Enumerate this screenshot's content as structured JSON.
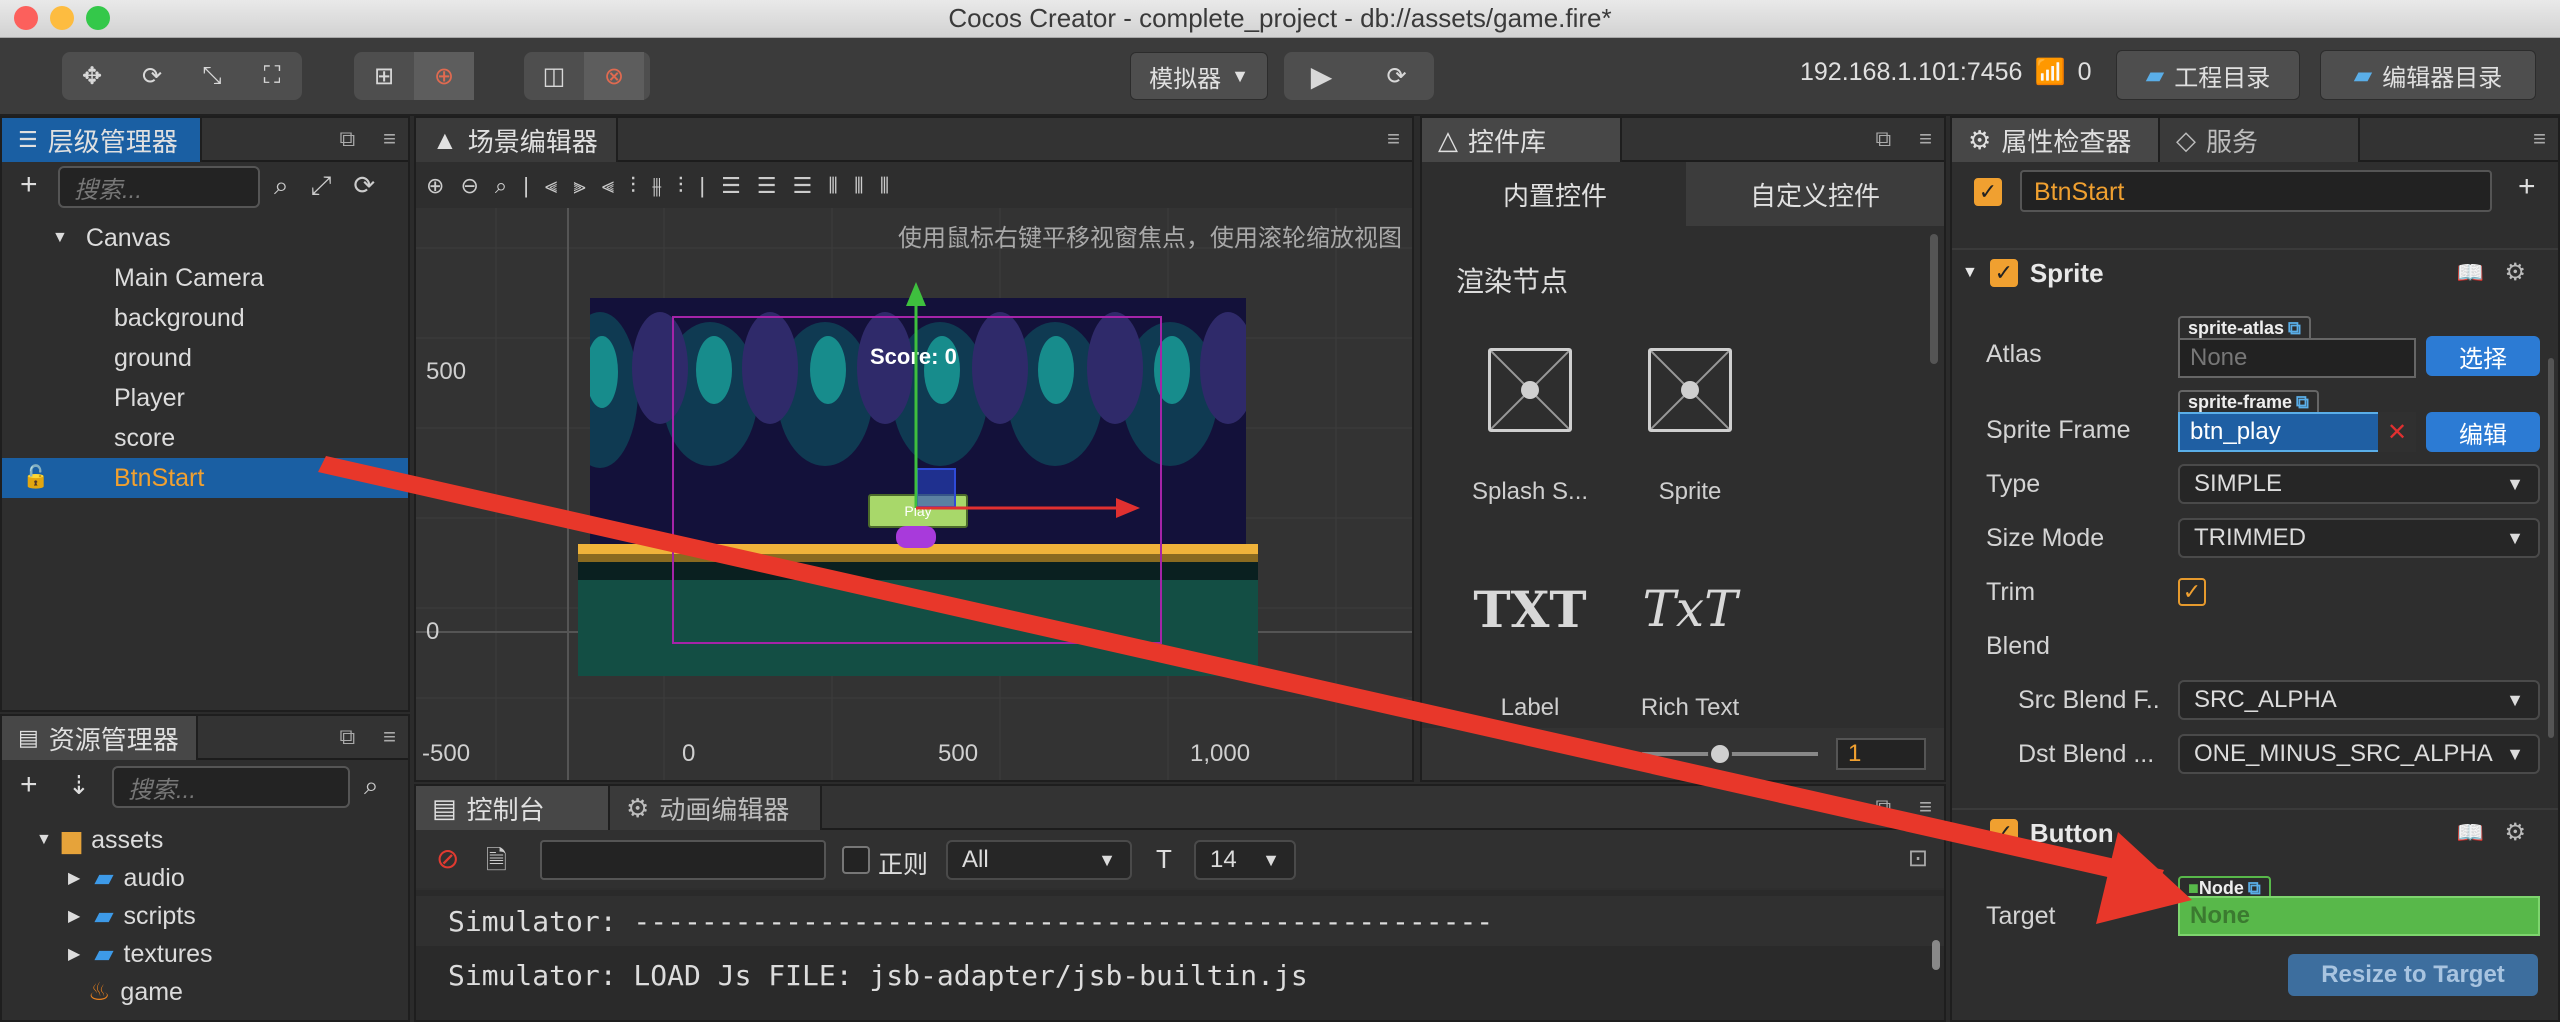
{
  "window": {
    "title": "Cocos Creator - complete_project - db://assets/game.fire*"
  },
  "toolbar": {
    "simulator_label": "模拟器",
    "ip": "192.168.1.101:7456",
    "wifi_count": "0",
    "project_dir_label": "工程目录",
    "editor_dir_label": "编辑器目录"
  },
  "hierarchy": {
    "tab": "层级管理器",
    "search_placeholder": "搜索...",
    "items": [
      "Canvas",
      "Main Camera",
      "background",
      "ground",
      "Player",
      "score",
      "BtnStart"
    ]
  },
  "scene": {
    "tab": "场景编辑器",
    "hint": "使用鼠标右键平移视窗焦点，使用滚轮缩放视图",
    "y_labels": [
      "500",
      "0"
    ],
    "x_labels": [
      "-500",
      "0",
      "500",
      "1,000"
    ],
    "score_text": "Score: 0",
    "play_text": "Play"
  },
  "widgets": {
    "tab": "控件库",
    "builtin_tab": "内置控件",
    "custom_tab": "自定义控件",
    "section": "渲染节点",
    "items": [
      "Splash S...",
      "Sprite",
      "Label",
      "Rich Text"
    ],
    "label_icon": "TXT",
    "richtext_icon": "TxT",
    "zoom_value": "1"
  },
  "assets": {
    "tab": "资源管理器",
    "search_placeholder": "搜索...",
    "items": [
      "assets",
      "audio",
      "scripts",
      "textures",
      "game"
    ]
  },
  "console": {
    "tab": "控制台",
    "anim_tab": "动画编辑器",
    "regex_label": "正则",
    "level": "All",
    "font_size": "14",
    "lines": [
      "Simulator: ---------------------------------------------------",
      "Simulator: LOAD Js FILE: jsb-adapter/jsb-builtin.js"
    ]
  },
  "inspector": {
    "tab": "属性检查器",
    "service_tab": "服务",
    "node_name": "BtnStart",
    "sprite": {
      "title": "Sprite",
      "atlas_label": "Atlas",
      "atlas_tag": "sprite-atlas",
      "atlas_value": "None",
      "select_btn": "选择",
      "frame_label": "Sprite Frame",
      "frame_tag": "sprite-frame",
      "frame_value": "btn_play",
      "edit_btn": "编辑",
      "type_label": "Type",
      "type_value": "SIMPLE",
      "sizemode_label": "Size Mode",
      "sizemode_value": "TRIMMED",
      "trim_label": "Trim",
      "blend_label": "Blend",
      "src_label": "Src Blend F..",
      "src_value": "SRC_ALPHA",
      "dst_label": "Dst Blend ...",
      "dst_value": "ONE_MINUS_SRC_ALPHA"
    },
    "button": {
      "title": "Button",
      "target_label": "Target",
      "node_tag": "Node",
      "target_value": "None",
      "resize_btn": "Resize to Target"
    }
  },
  "colors": {
    "accent": "#f0a030",
    "selection": "#1a5fa3",
    "arrow": "#e8372a",
    "node_green": "#58b84a"
  }
}
